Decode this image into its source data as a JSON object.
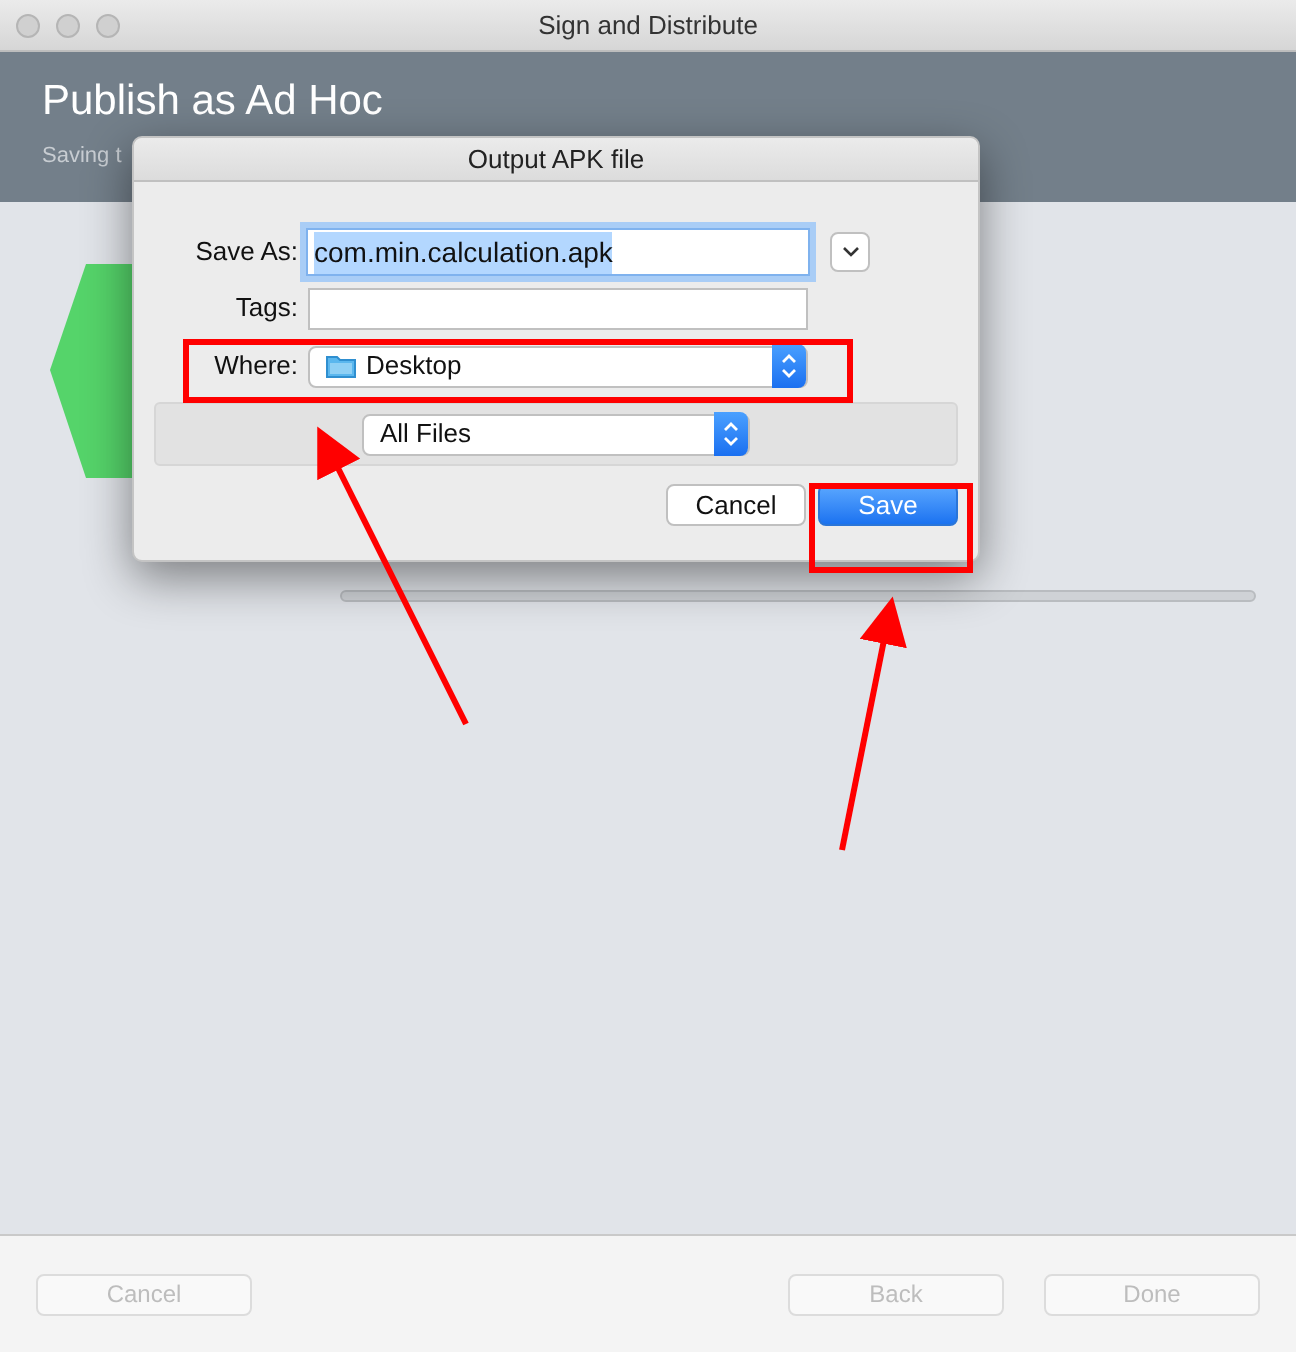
{
  "window": {
    "title": "Sign and Distribute"
  },
  "header": {
    "title": "Publish as Ad Hoc",
    "subtitle": "Saving t"
  },
  "dialog": {
    "title": "Output APK file",
    "save_as": {
      "label": "Save As:",
      "value": "com.min.calculation.apk",
      "selected": true
    },
    "tags": {
      "label": "Tags:"
    },
    "where": {
      "label": "Where:",
      "value": "Desktop"
    },
    "format": {
      "value": "All Files"
    },
    "buttons": [
      {
        "label": "Cancel",
        "default": false
      },
      {
        "label": "Save",
        "default": true
      }
    ]
  },
  "footer": {
    "buttons": [
      {
        "label": "Cancel",
        "disabled": true
      },
      {
        "label": "Back",
        "disabled": true
      },
      {
        "label": "Done",
        "disabled": true
      }
    ]
  }
}
